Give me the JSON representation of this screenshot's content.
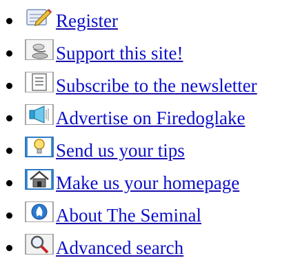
{
  "links": [
    {
      "label": "Register",
      "icon": "pencil-note-icon"
    },
    {
      "label": "Support this site!",
      "icon": "coin-stack-icon"
    },
    {
      "label": "Subscribe to the newsletter",
      "icon": "document-icon"
    },
    {
      "label": "Advertise on Firedoglake",
      "icon": "megaphone-icon"
    },
    {
      "label": "Send us your tips",
      "icon": "lightbulb-icon"
    },
    {
      "label": "Make us your homepage",
      "icon": "home-icon"
    },
    {
      "label": "About The Seminal",
      "icon": "logo-badge-icon"
    },
    {
      "label": "Advanced search",
      "icon": "magnifier-icon"
    }
  ],
  "colors": {
    "link": "#0c10c7",
    "bullet": "#000000"
  }
}
